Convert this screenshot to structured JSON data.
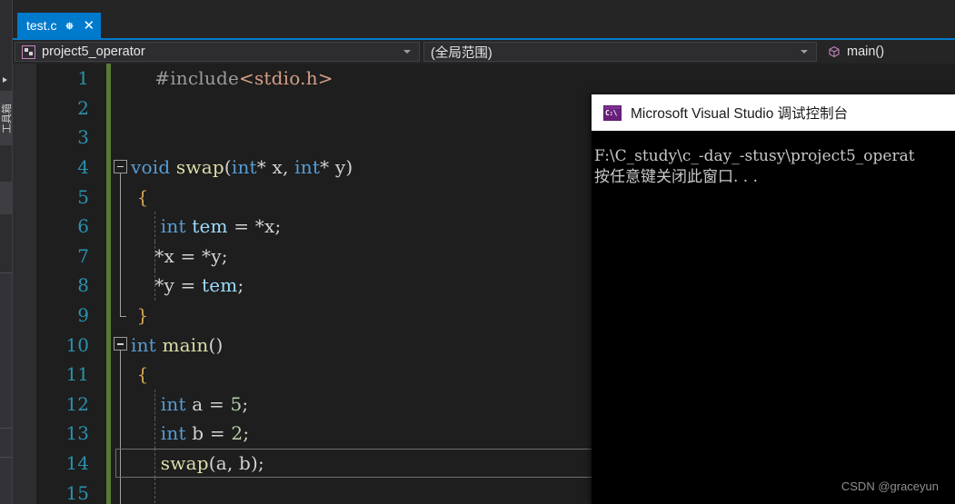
{
  "window": {
    "theme_accent": "#007acc",
    "editor_bg": "#1e1e1e",
    "chrome_bg": "#252526"
  },
  "left_tool_strip": {
    "vertical_tab_label": "工具箱",
    "chevron_icon": "chevron-right-icon"
  },
  "tab": {
    "filename": "test.c",
    "pin_icon": "pin-icon",
    "close_icon": "close-icon"
  },
  "navbar": {
    "project_icon": "project-icon",
    "project": "project5_operator",
    "scope": "(全局范围)",
    "member_icon": "method-cube-icon",
    "member": "main()",
    "caret_icon": "chevron-down-icon"
  },
  "editor": {
    "current_line": 14,
    "lines": [
      {
        "number": "1",
        "changed": true,
        "fold": "none",
        "indent_guides": [],
        "tokens": [
          {
            "t": "    ",
            "c": "pln"
          },
          {
            "t": "#include",
            "c": "pre"
          },
          {
            "t": "<stdio.h>",
            "c": "str"
          }
        ]
      },
      {
        "number": "2",
        "changed": true,
        "fold": "none",
        "indent_guides": [],
        "tokens": []
      },
      {
        "number": "3",
        "changed": true,
        "fold": "none",
        "indent_guides": [],
        "tokens": []
      },
      {
        "number": "4",
        "changed": true,
        "fold": "collapse-start",
        "indent_guides": [],
        "tokens": [
          {
            "t": "void",
            "c": "kw"
          },
          {
            "t": " ",
            "c": "pln"
          },
          {
            "t": "swap",
            "c": "fn"
          },
          {
            "t": "(",
            "c": "punc"
          },
          {
            "t": "int",
            "c": "kw"
          },
          {
            "t": "* ",
            "c": "punc"
          },
          {
            "t": "x",
            "c": "pln"
          },
          {
            "t": ", ",
            "c": "punc"
          },
          {
            "t": "int",
            "c": "kw"
          },
          {
            "t": "* ",
            "c": "punc"
          },
          {
            "t": "y",
            "c": "pln"
          },
          {
            "t": ")",
            "c": "punc"
          }
        ]
      },
      {
        "number": "5",
        "changed": true,
        "fold": "line",
        "indent_guides": [],
        "tokens": [
          {
            "t": " ",
            "c": "pln"
          },
          {
            "t": "{",
            "c": "brc"
          }
        ]
      },
      {
        "number": "6",
        "changed": true,
        "fold": "line",
        "indent_guides": [
          20
        ],
        "tokens": [
          {
            "t": "     ",
            "c": "pln"
          },
          {
            "t": "int",
            "c": "kw"
          },
          {
            "t": " ",
            "c": "pln"
          },
          {
            "t": "tem",
            "c": "var"
          },
          {
            "t": " = *",
            "c": "punc"
          },
          {
            "t": "x",
            "c": "pln"
          },
          {
            "t": ";",
            "c": "punc"
          }
        ]
      },
      {
        "number": "7",
        "changed": true,
        "fold": "line",
        "indent_guides": [
          20
        ],
        "tokens": [
          {
            "t": "    *",
            "c": "punc"
          },
          {
            "t": "x",
            "c": "pln"
          },
          {
            "t": " = *",
            "c": "punc"
          },
          {
            "t": "y",
            "c": "pln"
          },
          {
            "t": ";",
            "c": "punc"
          }
        ]
      },
      {
        "number": "8",
        "changed": true,
        "fold": "line",
        "indent_guides": [
          20
        ],
        "tokens": [
          {
            "t": "    *",
            "c": "punc"
          },
          {
            "t": "y",
            "c": "pln"
          },
          {
            "t": " = ",
            "c": "punc"
          },
          {
            "t": "tem",
            "c": "var"
          },
          {
            "t": ";",
            "c": "punc"
          }
        ]
      },
      {
        "number": "9",
        "changed": true,
        "fold": "end",
        "indent_guides": [],
        "tokens": [
          {
            "t": " ",
            "c": "pln"
          },
          {
            "t": "}",
            "c": "brc"
          }
        ]
      },
      {
        "number": "10",
        "changed": true,
        "fold": "collapse-start",
        "indent_guides": [],
        "tokens": [
          {
            "t": "int",
            "c": "kw"
          },
          {
            "t": " ",
            "c": "pln"
          },
          {
            "t": "main",
            "c": "fn"
          },
          {
            "t": "()",
            "c": "punc"
          }
        ]
      },
      {
        "number": "11",
        "changed": true,
        "fold": "line",
        "indent_guides": [],
        "tokens": [
          {
            "t": " ",
            "c": "pln"
          },
          {
            "t": "{",
            "c": "brc"
          }
        ]
      },
      {
        "number": "12",
        "changed": true,
        "fold": "line",
        "indent_guides": [
          20
        ],
        "tokens": [
          {
            "t": "     ",
            "c": "pln"
          },
          {
            "t": "int",
            "c": "kw"
          },
          {
            "t": " ",
            "c": "pln"
          },
          {
            "t": "a",
            "c": "pln"
          },
          {
            "t": " = ",
            "c": "punc"
          },
          {
            "t": "5",
            "c": "num"
          },
          {
            "t": ";",
            "c": "punc"
          }
        ]
      },
      {
        "number": "13",
        "changed": true,
        "fold": "line",
        "indent_guides": [
          20
        ],
        "tokens": [
          {
            "t": "     ",
            "c": "pln"
          },
          {
            "t": "int",
            "c": "kw"
          },
          {
            "t": " ",
            "c": "pln"
          },
          {
            "t": "b",
            "c": "pln"
          },
          {
            "t": " = ",
            "c": "punc"
          },
          {
            "t": "2",
            "c": "num"
          },
          {
            "t": ";",
            "c": "punc"
          }
        ]
      },
      {
        "number": "14",
        "changed": true,
        "fold": "line",
        "indent_guides": [
          20
        ],
        "tokens": [
          {
            "t": "     ",
            "c": "pln"
          },
          {
            "t": "swap",
            "c": "fn"
          },
          {
            "t": "(",
            "c": "punc"
          },
          {
            "t": "a",
            "c": "pln"
          },
          {
            "t": ", ",
            "c": "punc"
          },
          {
            "t": "b",
            "c": "pln"
          },
          {
            "t": ");",
            "c": "punc"
          }
        ]
      },
      {
        "number": "15",
        "changed": true,
        "fold": "line",
        "indent_guides": [
          20
        ],
        "tokens": []
      }
    ]
  },
  "console": {
    "icon": "console-app-icon",
    "title": "Microsoft Visual Studio 调试控制台",
    "lines": [
      "F:\\C_study\\c_-day_-stusy\\project5_operat",
      "按任意键关闭此窗口. . ."
    ]
  },
  "watermark": "CSDN @graceyun"
}
